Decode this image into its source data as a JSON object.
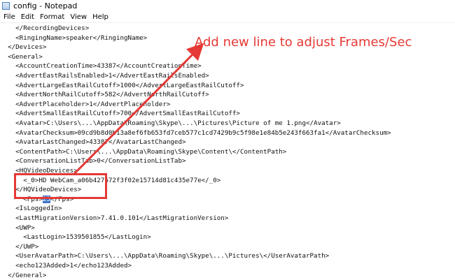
{
  "window": {
    "title": "config - Notepad"
  },
  "menu": [
    "File",
    "Edit",
    "Format",
    "View",
    "Help"
  ],
  "lines": [
    "    </RecordingDevices>",
    "    <RingingName>speaker</RingingName>",
    "  </Devices>",
    "  <General>",
    "    <AccountCreationTime>43387</AccountCreationTime>",
    "    <AdvertEastRailsEnabled>1</AdvertEastRailsEnabled>",
    "    <AdvertLargeEastRailCutoff>1000</AdvertLargeEastRailCutoff>",
    "    <AdvertNorthRailCutoff>582</AdvertNorthRailCutoff>",
    "    <AdvertPlaceholder>1</AdvertPlaceholder>",
    "    <AdvertSmallEastRailCutoff>700</AdvertSmallEastRailCutoff>",
    "    <Avatar>C:\\Users\\...\\AppData\\Roaming\\Skype\\...\\Pictures\\Picture of me 1.png</Avatar>",
    "    <AvatarChecksum>09cd9b8d0b13a8ef6fb653fd7ceb577c1cd7429b9c5f98e1e84b5e243f663fa1</AvatarChecksum>",
    "    <AvatarLastChanged>43387</AvatarLastChanged>",
    "    <ContentPath>C:\\Users\\...\\AppData\\Roaming\\Skype\\Content\\</ContentPath>",
    "    <ConversationListTab>0</ConversationListTab>",
    "    <HQVideoDevices>",
    "      <_0>HD WebCam_a06b427672f3f02e15714d81c435e77e</_0>",
    "    </HQVideoDevices>",
    "",
    "    <IsLoggedIn>",
    "    <LastMigrationVersion>7.41.0.101</LastMigrationVersion>",
    "    <UWP>",
    "      <LastLogin>1539501855</LastLogin>",
    "    </UWP>",
    "    <UserAvatarPath>C:\\Users\\...\\AppData\\Roaming\\Skype\\...\\Pictures\\</UserAvatarPath>",
    "    <echo123Added>1</echo123Added>",
    "  </General>"
  ],
  "fps_line": {
    "open": "      <Fps>",
    "value": "25",
    "close": "</Fps>"
  },
  "annotation": {
    "text": "Add new line to adjust Frames/Sec",
    "color": "#e53935"
  }
}
